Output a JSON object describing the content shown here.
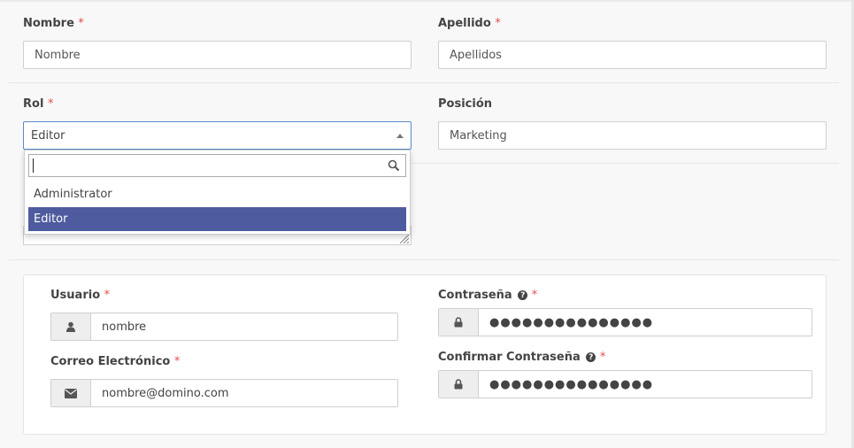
{
  "form": {
    "nombre": {
      "label": "Nombre",
      "required_mark": "*",
      "placeholder": "Nombre"
    },
    "apellido": {
      "label": "Apellido",
      "required_mark": "*",
      "placeholder": "Apellidos"
    },
    "rol": {
      "label": "Rol",
      "required_mark": "*",
      "value": "Editor",
      "dropdown": {
        "search_value": "",
        "options": [
          "Administrator",
          "Editor"
        ],
        "selected": "Editor"
      }
    },
    "posicion": {
      "label": "Posición",
      "value": "Marketing"
    },
    "usuario": {
      "label": "Usuario",
      "required_mark": "*",
      "placeholder": "nombre",
      "icon": "user-icon"
    },
    "correo": {
      "label": "Correo Electrónico",
      "required_mark": "*",
      "placeholder": "nombre@domino.com",
      "icon": "envelope-icon"
    },
    "contrasena": {
      "label": "Contraseña",
      "required_mark": "*",
      "help": "?",
      "value": "●●●●●●●●●●●●●●●",
      "icon": "lock-icon"
    },
    "confirmar": {
      "label": "Confirmar Contraseña",
      "required_mark": "*",
      "help": "?",
      "value": "●●●●●●●●●●●●●●●",
      "icon": "lock-icon"
    }
  },
  "colors": {
    "accent": "#4e5b9e",
    "required": "#e05050",
    "focus_border": "#5b89c9"
  }
}
